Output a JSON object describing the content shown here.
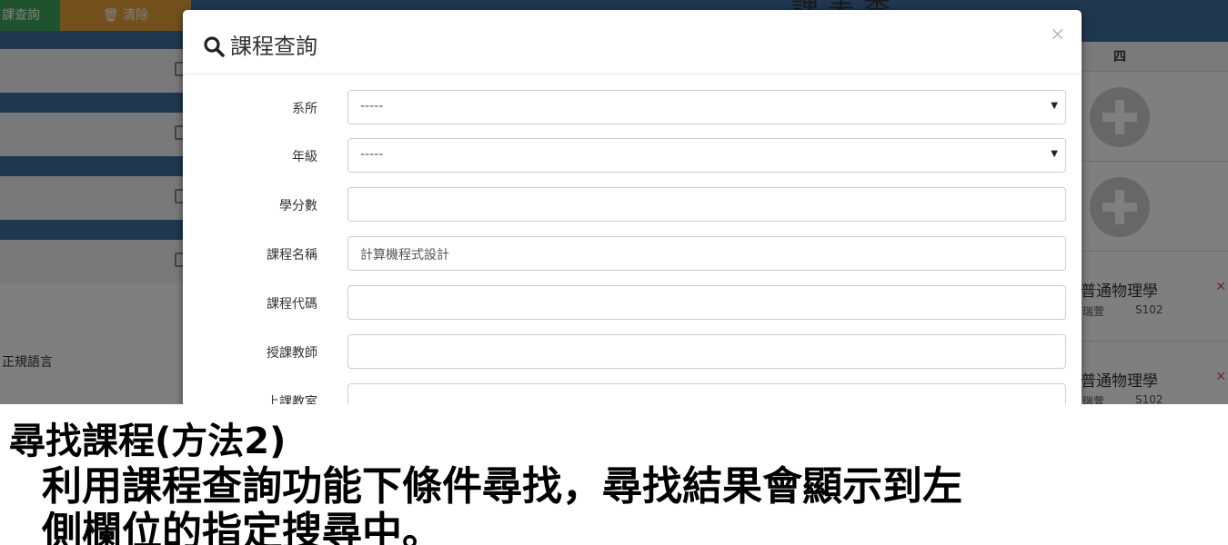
{
  "background": {
    "toolbar": {
      "search_label": "課查詢",
      "clear_label": "🗑 清除"
    },
    "title": "課 表 查",
    "left_text": "正規語言",
    "day_header": "四",
    "courses": [
      {
        "name": "普通物理學",
        "teacher": "瑞萱",
        "room": "S102"
      },
      {
        "name": "普通物理學",
        "teacher": "瑞萱",
        "room": "S102"
      }
    ]
  },
  "modal": {
    "title": "課程查詢",
    "close": "×",
    "fields": {
      "dept": {
        "label": "系所",
        "value": "-----"
      },
      "grade": {
        "label": "年級",
        "value": "-----"
      },
      "credits": {
        "label": "學分數",
        "value": ""
      },
      "course_name": {
        "label": "課程名稱",
        "value": "計算機程式設計"
      },
      "course_code": {
        "label": "課程代碼",
        "value": ""
      },
      "teacher": {
        "label": "授課教師",
        "value": ""
      },
      "classroom": {
        "label": "上課教室",
        "value": ""
      }
    }
  },
  "caption": {
    "line1": "尋找課程(方法2)",
    "line2": "利用課程查詢功能下條件尋找，尋找結果會顯示到左",
    "line3": "側欄位的指定搜尋中。"
  }
}
